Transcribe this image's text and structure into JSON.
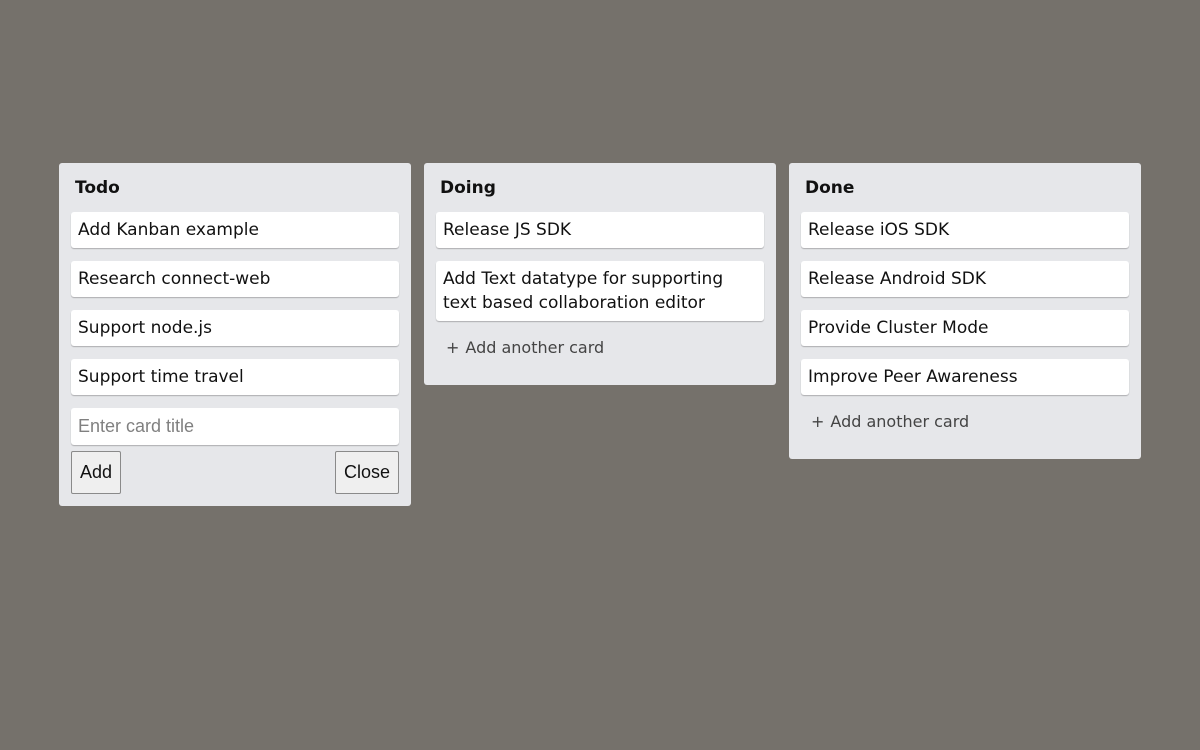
{
  "columns": [
    {
      "title": "Todo",
      "cards": [
        "Add Kanban example",
        "Research connect-web",
        "Support node.js",
        "Support time travel"
      ],
      "form": {
        "placeholder": "Enter card title",
        "add_label": "Add",
        "close_label": "Close"
      }
    },
    {
      "title": "Doing",
      "cards": [
        "Release JS SDK",
        "Add Text datatype for supporting text based collaboration editor"
      ],
      "add_another": {
        "icon": "+",
        "label": "Add another card"
      }
    },
    {
      "title": "Done",
      "cards": [
        "Release iOS SDK",
        "Release Android SDK",
        "Provide Cluster Mode",
        "Improve Peer Awareness"
      ],
      "add_another": {
        "icon": "+",
        "label": "Add another card"
      }
    }
  ],
  "colors": {
    "background": "#75716b",
    "column": "#e6e7ea",
    "card": "#ffffff"
  }
}
